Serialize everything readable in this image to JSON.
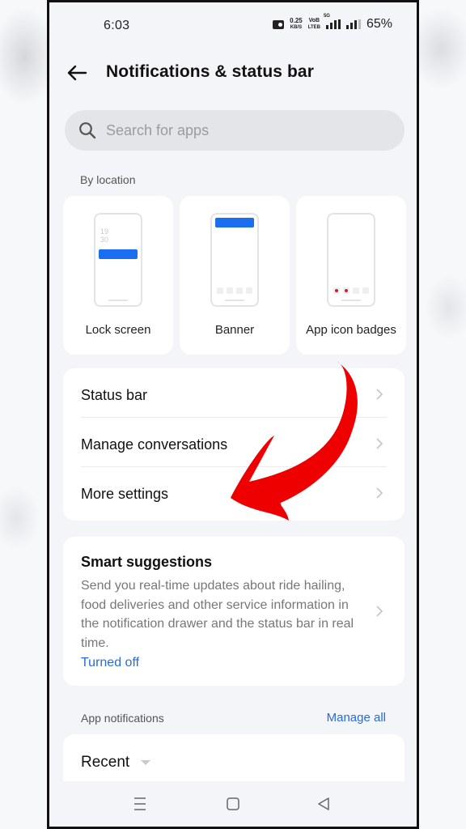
{
  "status_bar": {
    "time": "6:03",
    "net_speed_value": "0.25",
    "net_speed_unit": "KB/S",
    "volte_top": "VoB",
    "volte_bottom": "LTEB",
    "network_type": "5G",
    "battery": "65%"
  },
  "header": {
    "back_icon": "arrow-left-icon",
    "title": "Notifications & status bar"
  },
  "search": {
    "icon": "search-icon",
    "placeholder": "Search for apps",
    "value": ""
  },
  "by_location": {
    "label": "By location",
    "cards": [
      {
        "label": "Lock screen",
        "preview_clock": [
          "19",
          "30"
        ]
      },
      {
        "label": "Banner"
      },
      {
        "label": "App icon badges"
      }
    ]
  },
  "settings_list": [
    {
      "label": "Status bar",
      "icon": "chevron-right-icon"
    },
    {
      "label": "Manage conversations",
      "icon": "chevron-right-icon"
    },
    {
      "label": "More settings",
      "icon": "chevron-right-icon"
    }
  ],
  "smart_suggestions": {
    "title": "Smart suggestions",
    "description": "Send you real-time updates about ride hailing, food deliveries and other service information in the notification drawer and the status bar in real time.",
    "status": "Turned off"
  },
  "app_notifications": {
    "label": "App notifications",
    "manage_all": "Manage all",
    "sort_selected": "Recent"
  },
  "nav_bar": {
    "recents_icon": "menu-lines-icon",
    "home_icon": "square-home-icon",
    "back_icon": "triangle-back-icon"
  },
  "colors": {
    "accent_blue": "#2a6bd2",
    "notif_blue": "#1a6ef0",
    "annotation_arrow": "#ee0000",
    "badge_red": "#c9232a"
  }
}
